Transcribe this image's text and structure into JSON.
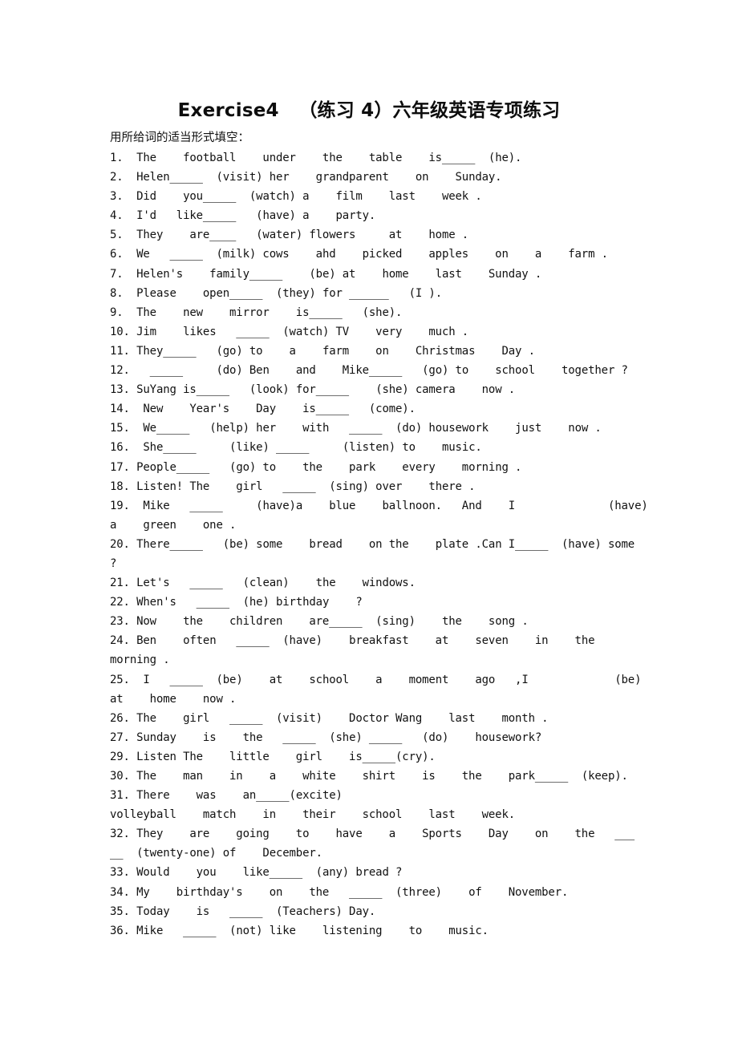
{
  "document": {
    "title": "Exercise4   （练习 4）六年级英语专项练习",
    "instruction": "用所给词的适当形式填空："
  },
  "questions": [
    {
      "num": "1.",
      "lines": [
        [
          {
            "t": "  The    football    under    the    table    is"
          },
          {
            "b": "_____"
          },
          {
            "t": "  (he)."
          }
        ]
      ]
    },
    {
      "num": "2.",
      "lines": [
        [
          {
            "t": "  Helen"
          },
          {
            "b": "_____"
          },
          {
            "t": "  (visit) her    grandparent    on    Sunday."
          }
        ]
      ]
    },
    {
      "num": "3.",
      "lines": [
        [
          {
            "t": "  Did    you"
          },
          {
            "b": "_____"
          },
          {
            "t": "  (watch) a    film    last    week ."
          }
        ]
      ]
    },
    {
      "num": "4.",
      "lines": [
        [
          {
            "t": "  I'd   like"
          },
          {
            "b": "_____"
          },
          {
            "t": "   (have) a    party."
          }
        ]
      ]
    },
    {
      "num": "5.",
      "lines": [
        [
          {
            "t": "  They    are"
          },
          {
            "b": "____"
          },
          {
            "t": "   (water) flowers     at    home ."
          }
        ]
      ]
    },
    {
      "num": "6.",
      "lines": [
        [
          {
            "t": "  We   "
          },
          {
            "b": "_____"
          },
          {
            "t": "  (milk) cows    ahd    picked    apples    on    a    farm ."
          }
        ]
      ]
    },
    {
      "num": "7.",
      "lines": [
        [
          {
            "t": "  Helen's    family"
          },
          {
            "b": "_____"
          },
          {
            "t": "    (be) at    home    last    Sunday ."
          }
        ]
      ]
    },
    {
      "num": "8.",
      "lines": [
        [
          {
            "t": "  Please    open"
          },
          {
            "b": "_____"
          },
          {
            "t": "  (they) for "
          },
          {
            "b": "______"
          },
          {
            "t": "   (I )."
          }
        ]
      ]
    },
    {
      "num": "9.",
      "lines": [
        [
          {
            "t": "  The    new    mirror    is"
          },
          {
            "b": "_____"
          },
          {
            "t": "   (she)."
          }
        ]
      ]
    },
    {
      "num": "10.",
      "lines": [
        [
          {
            "t": " Jim    likes   "
          },
          {
            "b": "_____"
          },
          {
            "t": "  (watch) TV    very    much ."
          }
        ]
      ]
    },
    {
      "num": "11.",
      "lines": [
        [
          {
            "t": " They"
          },
          {
            "b": "_____"
          },
          {
            "t": "   (go) to    a    farm    on    Christmas    Day ."
          }
        ]
      ]
    },
    {
      "num": "12.",
      "lines": [
        [
          {
            "t": "   "
          },
          {
            "b": "_____"
          },
          {
            "t": "     (do) Ben    and    Mike"
          },
          {
            "b": "_____"
          },
          {
            "t": "   (go) to    school    together ?"
          }
        ]
      ]
    },
    {
      "num": "13.",
      "lines": [
        [
          {
            "t": " SuYang is"
          },
          {
            "b": "_____"
          },
          {
            "t": "   (look) for"
          },
          {
            "b": "_____"
          },
          {
            "t": "    (she) camera    now ."
          }
        ]
      ]
    },
    {
      "num": "14.",
      "lines": [
        [
          {
            "t": "  New    Year's    Day    is"
          },
          {
            "b": "_____"
          },
          {
            "t": "   (come)."
          }
        ]
      ]
    },
    {
      "num": "15.",
      "lines": [
        [
          {
            "t": "  We"
          },
          {
            "b": "_____"
          },
          {
            "t": "   (help) her    with   "
          },
          {
            "b": "_____"
          },
          {
            "t": "  (do) housework    just    now ."
          }
        ]
      ]
    },
    {
      "num": "16.",
      "lines": [
        [
          {
            "t": "  She"
          },
          {
            "b": "_____"
          },
          {
            "t": "     (like) "
          },
          {
            "b": "_____"
          },
          {
            "t": "     (listen) to    music."
          }
        ]
      ]
    },
    {
      "num": "17.",
      "lines": [
        [
          {
            "t": " People"
          },
          {
            "b": "_____"
          },
          {
            "t": "   (go) to    the    park    every    morning ."
          }
        ]
      ]
    },
    {
      "num": "18.",
      "lines": [
        [
          {
            "t": " Listen! The    girl   "
          },
          {
            "b": "_____"
          },
          {
            "t": "  (sing) over    there ."
          }
        ]
      ]
    },
    {
      "num": "19.",
      "lines": [
        [
          {
            "t": "  Mike   "
          },
          {
            "b": "_____"
          },
          {
            "t": "     (have)a    blue    ballnoon.   And    I"
          },
          {
            "g": "            "
          },
          {
            "t": "  (have)"
          }
        ],
        [
          {
            "t": "a    green    one ."
          }
        ]
      ]
    },
    {
      "num": "20.",
      "lines": [
        [
          {
            "t": " There"
          },
          {
            "b": "_____"
          },
          {
            "t": "   (be) some    bread    on the    plate .Can I"
          },
          {
            "b": "_____"
          },
          {
            "t": "  (have) some"
          }
        ],
        [
          {
            "t": "?"
          }
        ]
      ]
    },
    {
      "num": "21.",
      "lines": [
        [
          {
            "t": " Let's   "
          },
          {
            "b": "_____"
          },
          {
            "t": "   (clean)    the    windows."
          }
        ]
      ]
    },
    {
      "num": "22.",
      "lines": [
        [
          {
            "t": " When's   "
          },
          {
            "b": "_____"
          },
          {
            "t": "  (he) birthday    ?"
          }
        ]
      ]
    },
    {
      "num": "23.",
      "lines": [
        [
          {
            "t": " Now    the    children    are"
          },
          {
            "b": "_____"
          },
          {
            "t": "  (sing)    the    song ."
          }
        ]
      ]
    },
    {
      "num": "24.",
      "lines": [
        [
          {
            "t": " Ben    often   "
          },
          {
            "b": "_____"
          },
          {
            "t": "  (have)    breakfast    at    seven    in    the"
          }
        ],
        [
          {
            "t": "morning ."
          }
        ]
      ]
    },
    {
      "num": "25.",
      "lines": [
        [
          {
            "t": "  I   "
          },
          {
            "b": "_____"
          },
          {
            "t": "  (be)    at    school    a    moment    ago   ,I"
          },
          {
            "g": "           "
          },
          {
            "t": "  (be)"
          }
        ],
        [
          {
            "t": "at    home    now ."
          }
        ]
      ]
    },
    {
      "num": "26.",
      "lines": [
        [
          {
            "t": " The    girl   "
          },
          {
            "b": "_____"
          },
          {
            "t": "  (visit)    Doctor Wang    last    month ."
          }
        ]
      ]
    },
    {
      "num": "27.",
      "lines": [
        [
          {
            "t": " Sunday    is    the   "
          },
          {
            "b": "_____"
          },
          {
            "t": "  (she) "
          },
          {
            "b": "_____"
          },
          {
            "t": "   (do)    housework?"
          }
        ]
      ]
    },
    {
      "num": "29.",
      "lines": [
        [
          {
            "t": " Listen The    little    girl    is"
          },
          {
            "b": "_____"
          },
          {
            "t": "(cry)."
          }
        ]
      ]
    },
    {
      "num": "30.",
      "lines": [
        [
          {
            "t": " The    man    in    a    white    shirt    is    the    park"
          },
          {
            "b": "_____"
          },
          {
            "t": "  (keep)."
          }
        ]
      ]
    },
    {
      "num": "31.",
      "lines": [
        [
          {
            "t": " There    was    an"
          },
          {
            "b": "_____"
          },
          {
            "t": "(excite)"
          }
        ],
        [
          {
            "t": "volleyball    match    in    their    school    last    week."
          }
        ]
      ]
    },
    {
      "num": "32.",
      "lines": [
        [
          {
            "t": " They    are    going    to    have    a    Sports    Day    on    the   "
          },
          {
            "b": "___"
          }
        ],
        [
          {
            "b": "__"
          },
          {
            "t": "  (twenty-one) of    December."
          }
        ]
      ]
    },
    {
      "num": "33.",
      "lines": [
        [
          {
            "t": " Would    you    like"
          },
          {
            "b": "_____"
          },
          {
            "t": "  (any) bread ?"
          }
        ]
      ]
    },
    {
      "num": "34.",
      "lines": [
        [
          {
            "t": " My    birthday's    on    the   "
          },
          {
            "b": "_____"
          },
          {
            "t": "  (three)    of    November."
          }
        ]
      ]
    },
    {
      "num": "35.",
      "lines": [
        [
          {
            "t": " Today    is   "
          },
          {
            "b": "_____"
          },
          {
            "t": "  (Teachers) Day."
          }
        ]
      ]
    },
    {
      "num": "36.",
      "lines": [
        [
          {
            "t": " Mike   "
          },
          {
            "b": "_____"
          },
          {
            "t": "  (not) like    listening    to    music."
          }
        ]
      ]
    }
  ]
}
